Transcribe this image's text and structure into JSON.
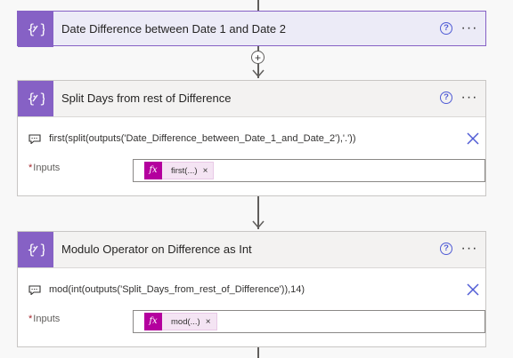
{
  "cards": [
    {
      "title": "Date Difference between Date 1 and Date 2",
      "help_glyph": "?",
      "more_glyph": "···",
      "icon": "variable-expression-icon"
    },
    {
      "title": "Split Days from rest of Difference",
      "help_glyph": "?",
      "more_glyph": "···",
      "icon": "variable-expression-icon",
      "expression": "first(split(outputs('Date_Difference_between_Date_1_and_Date_2'),'.'))",
      "inputs_required": "*",
      "inputs_label": "Inputs",
      "token_fx": "fx",
      "token_label": "first(...)",
      "token_remove": "×"
    },
    {
      "title": "Modulo Operator on Difference as Int",
      "help_glyph": "?",
      "more_glyph": "···",
      "icon": "variable-expression-icon",
      "expression": "mod(int(outputs('Split_Days_from_rest_of_Difference')),14)",
      "inputs_required": "*",
      "inputs_label": "Inputs",
      "token_fx": "fx",
      "token_label": "mod(...)",
      "token_remove": "×"
    }
  ],
  "insert_step_glyph": "+",
  "colors": {
    "accent_purple": "#8661c5",
    "help_blue": "#4f5bd5",
    "fx_magenta": "#b4009e",
    "token_bg": "#f4e4f3",
    "required_red": "#a4262c"
  }
}
